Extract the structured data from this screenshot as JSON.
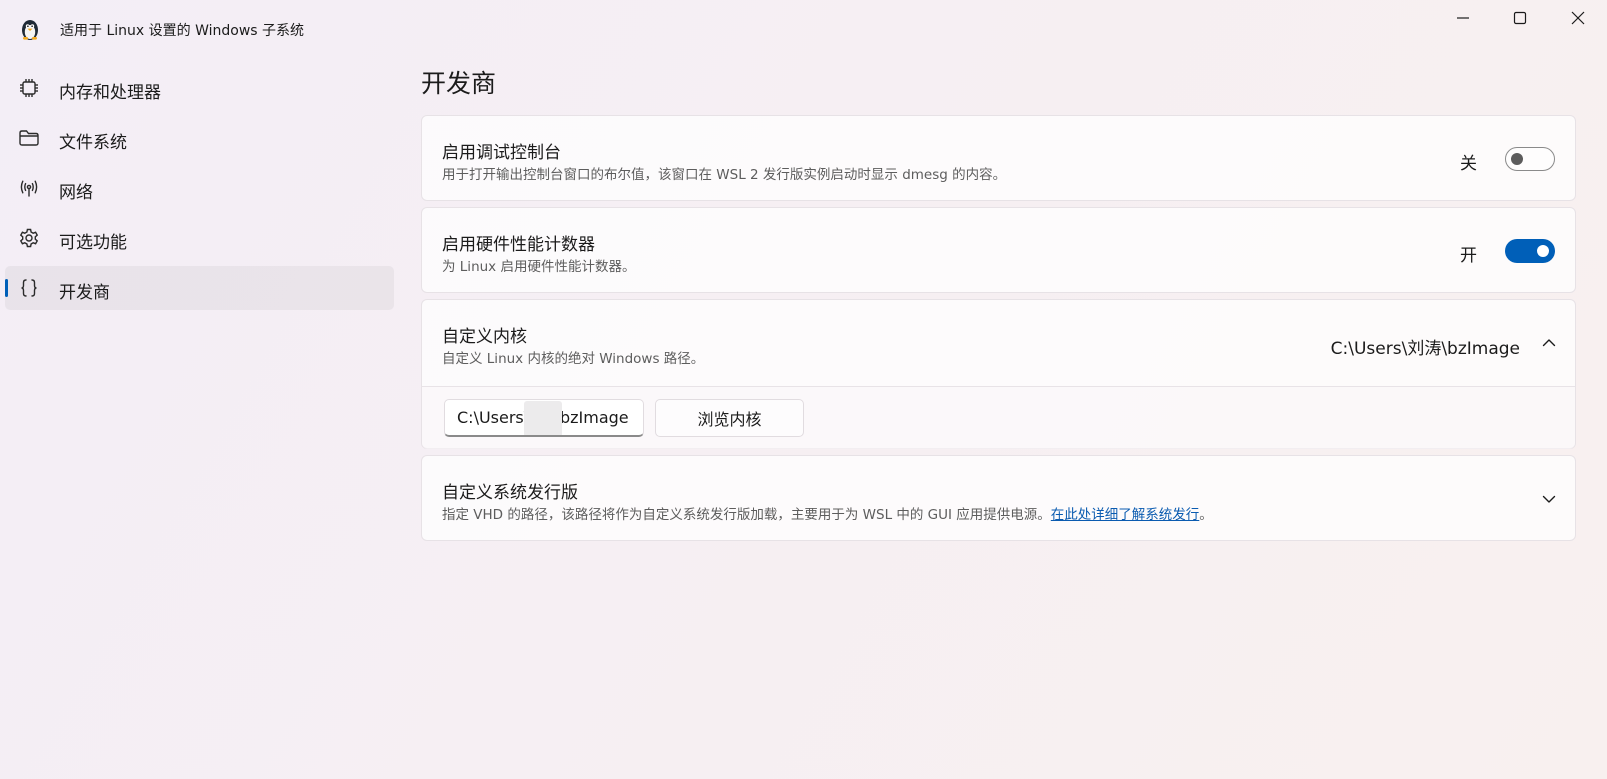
{
  "window": {
    "title": "适用于 Linux 设置的 Windows 子系统",
    "controls": [
      "minimize",
      "maximize",
      "close"
    ]
  },
  "sidebar": {
    "items": [
      {
        "label": "内存和处理器",
        "icon": "cpu-icon",
        "selected": false
      },
      {
        "label": "文件系统",
        "icon": "folder-icon",
        "selected": false
      },
      {
        "label": "网络",
        "icon": "antenna-icon",
        "selected": false
      },
      {
        "label": "可选功能",
        "icon": "gear-icon",
        "selected": false
      },
      {
        "label": "开发商",
        "icon": "braces-icon",
        "selected": true
      }
    ]
  },
  "main": {
    "title": "开发商",
    "debug_console": {
      "title": "启用调试控制台",
      "description": "用于打开输出控制台窗口的布尔值，该窗口在 WSL 2 发行版实例启动时显示 dmesg 的内容。",
      "state_label": "关",
      "enabled": false
    },
    "hw_counters": {
      "title": "启用硬件性能计数器",
      "description": "为 Linux 启用硬件性能计数器。",
      "state_label": "开",
      "enabled": true
    },
    "custom_kernel": {
      "title": "自定义内核",
      "description": "自定义 Linux 内核的绝对 Windows 路径。",
      "value": "C:\\Users\\刘涛\\bzImage",
      "input_value": "C:\\Users\\     \\bzImage",
      "browse_label": "浏览内核",
      "expanded": true
    },
    "custom_distro": {
      "title": "自定义系统发行版",
      "description": "指定 VHD 的路径，该路径将作为自定义系统发行版加载，主要用于为 WSL 中的 GUI 应用提供电源。",
      "link_text": "在此处详细了解系统发行",
      "suffix": "。",
      "expanded": false
    }
  },
  "colors": {
    "accent": "#005fb8",
    "link": "#0a5bb0"
  }
}
